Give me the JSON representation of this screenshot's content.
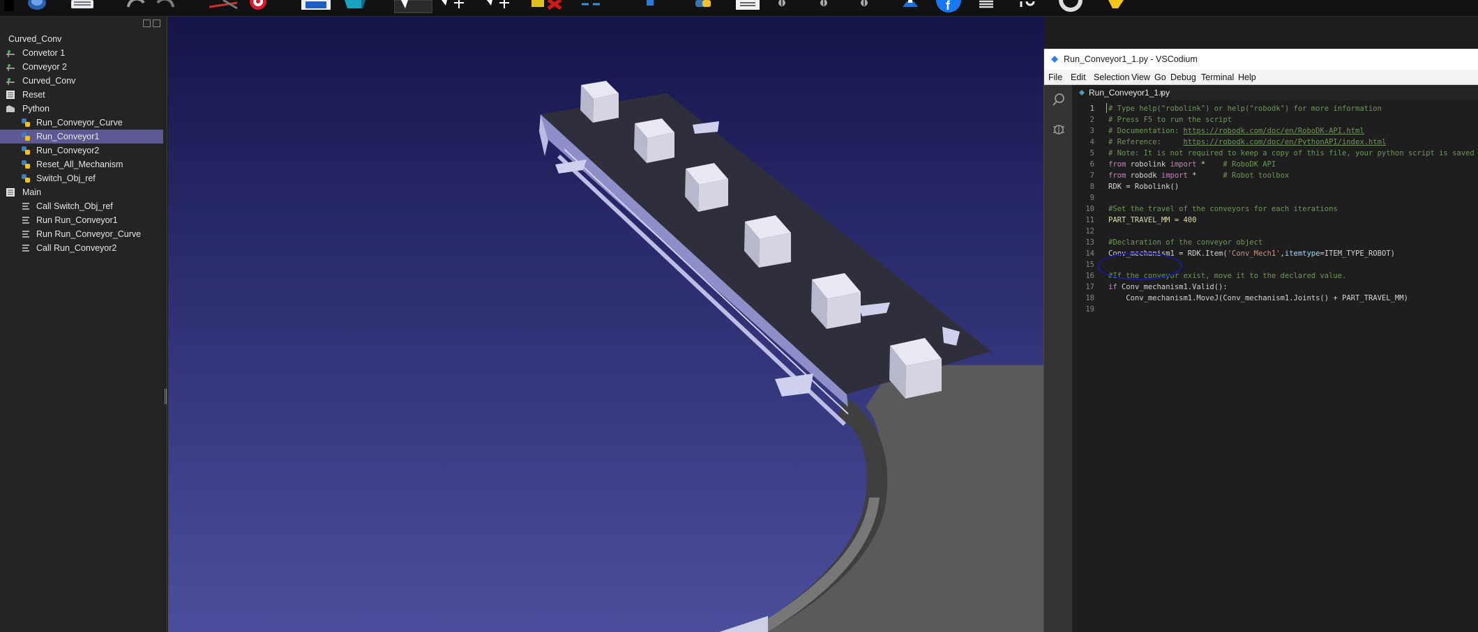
{
  "toolbar": {
    "icons": [
      "globe-icon",
      "save-icon",
      "undo-icon",
      "redo-icon",
      "teach-target-icon",
      "target-icon",
      "reference-frame-icon",
      "object-cube-icon",
      "select-pointer-icon",
      "move-reference-icon",
      "move-tool-icon",
      "collision-icon",
      "measure-icon",
      "program-icon",
      "python-icon",
      "list-icon",
      "run-icon",
      "step-icon",
      "loop-icon",
      "export-icon",
      "facebook-icon",
      "menu-icon",
      "time-icon",
      "sync-icon",
      "tag-icon"
    ]
  },
  "tree": {
    "items": [
      {
        "label": "Curved_Conv",
        "icon": "station-icon",
        "indent": 0,
        "selected": false
      },
      {
        "label": "Convetor 1",
        "icon": "robot-icon",
        "indent": 1,
        "selected": false
      },
      {
        "label": "Conveyor 2",
        "icon": "robot-icon",
        "indent": 1,
        "selected": false
      },
      {
        "label": "Curved_Conv",
        "icon": "robot-icon",
        "indent": 1,
        "selected": false
      },
      {
        "label": "Reset",
        "icon": "program-icon",
        "indent": 1,
        "selected": false
      },
      {
        "label": "Python",
        "icon": "folder-icon",
        "indent": 1,
        "selected": false
      },
      {
        "label": "Run_Conveyor_Curve",
        "icon": "python-icon",
        "indent": 2,
        "selected": false
      },
      {
        "label": "Run_Conveyor1",
        "icon": "python-icon",
        "indent": 2,
        "selected": true
      },
      {
        "label": "Run_Conveyor2",
        "icon": "python-icon",
        "indent": 2,
        "selected": false
      },
      {
        "label": "Reset_All_Mechanism",
        "icon": "python-icon",
        "indent": 2,
        "selected": false
      },
      {
        "label": "Switch_Obj_ref",
        "icon": "python-icon",
        "indent": 2,
        "selected": false
      },
      {
        "label": "Main",
        "icon": "program-icon",
        "indent": 1,
        "selected": false
      },
      {
        "label": "Call Switch_Obj_ref",
        "icon": "instruction-icon",
        "indent": 2,
        "selected": false
      },
      {
        "label": "Run Run_Conveyor1",
        "icon": "instruction-icon",
        "indent": 2,
        "selected": false
      },
      {
        "label": "Run Run_Conveyor_Curve",
        "icon": "instruction-icon",
        "indent": 2,
        "selected": false
      },
      {
        "label": "Call Run_Conveyor2",
        "icon": "instruction-icon",
        "indent": 2,
        "selected": false
      }
    ]
  },
  "viewport": {
    "background_top": "#15154a",
    "background_bottom": "#4b4e9c",
    "belt_color": "#2f2f3b",
    "curve_color": "#5c5c5c",
    "box_color": "#dcdcea",
    "box_count": 6
  },
  "vscode": {
    "window_title": "Run_Conveyor1_1.py - VSCodium",
    "menu": [
      "File",
      "Edit",
      "Selection",
      "View",
      "Go",
      "Debug",
      "Terminal",
      "Help"
    ],
    "tab": {
      "name": "Run_Conveyor1_1.py",
      "close": "×"
    },
    "activity_icons": [
      "search-icon",
      "debug-icon"
    ],
    "code": [
      "# Type help(\"robolink\") or help(\"robodk\") for more information",
      "# Press F5 to run the script",
      "# Documentation: https://robodk.com/doc/en/RoboDK-API.html",
      "# Reference:     https://robodk.com/doc/en/PythonAPI/index.html",
      "# Note: It is not required to keep a copy of this file, your python script is saved",
      "from robolink import *    # RoboDK API",
      "from robodk import *      # Robot toolbox",
      "RDK = Robolink()",
      "",
      "#Set the travel of the conveyors for each iterations",
      "PART_TRAVEL_MM = 400",
      "",
      "#Declaration of the conveyor object",
      "Conv_mechanism1 = RDK.Item('Conv_Mech1',itemtype=ITEM_TYPE_ROBOT)",
      "",
      "#If the conveyor exist, move it to the declared value.",
      "if Conv_mechanism1.Valid():",
      "    Conv_mechanism1.MoveJ(Conv_mechanism1.Joints() + PART_TRAVEL_MM)",
      ""
    ],
    "line_numbers": [
      "1",
      "2",
      "3",
      "4",
      "5",
      "6",
      "7",
      "8",
      "9",
      "10",
      "11",
      "12",
      "13",
      "14",
      "15",
      "16",
      "17",
      "18",
      "19"
    ],
    "colors": {
      "comment": "#6a9955",
      "keyword": "#c586c0",
      "highlight": "#dcdcaa",
      "string": "#ce9178",
      "attr": "#9cdcfe"
    }
  }
}
